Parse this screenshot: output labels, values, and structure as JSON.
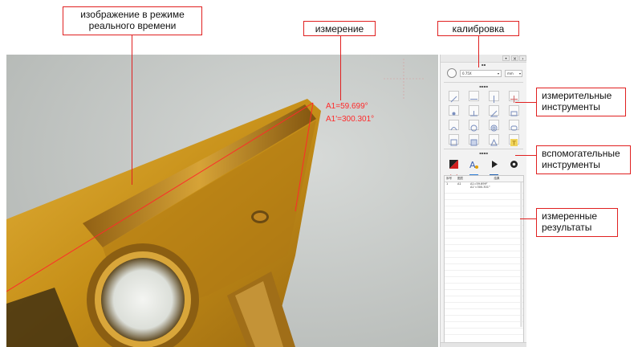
{
  "callouts": {
    "live_image": "изображение в режиме реального времени",
    "measurement": "измерение",
    "calibration": "калибровка",
    "measure_tools": "измерительные инструменты",
    "aux_tools": "вспомогательные инструменты",
    "results": "измеренные результаты"
  },
  "overlay": {
    "angle_a1": "A1=59.699°",
    "angle_a1_prime": "A1'=300.301°"
  },
  "panel": {
    "calibration": {
      "magnification": "0.75X",
      "unit": "mm"
    },
    "results_table": {
      "columns": [
        "序号",
        "图层",
        "结果"
      ],
      "rows": [
        {
          "index": "1",
          "layer": "A1",
          "result_1": "A1=59.699°",
          "result_2": "A1'=300.301°"
        }
      ]
    }
  },
  "colors": {
    "callout_border": "#e02020",
    "overlay_text": "#ff2a2a",
    "insert_gold": "#c9921a",
    "background_gray": "#c2c6c3"
  }
}
